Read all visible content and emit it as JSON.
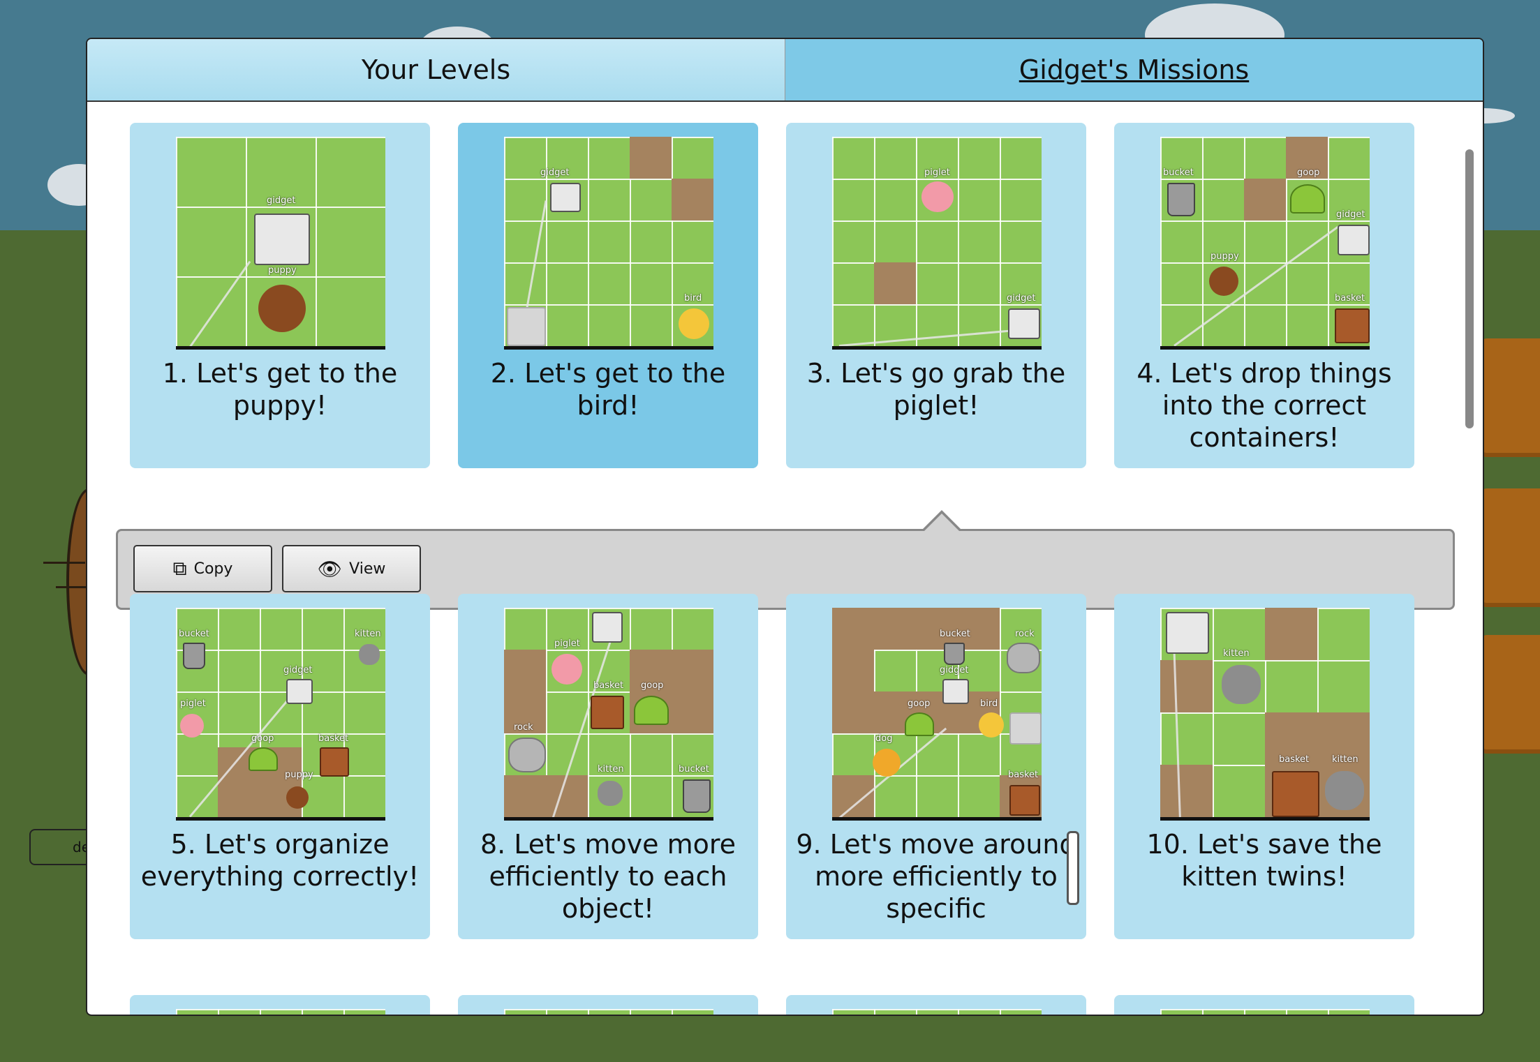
{
  "tabs": {
    "your_levels": "Your Levels",
    "missions": "Gidget's Missions"
  },
  "actions": {
    "copy": "Copy",
    "view": "View"
  },
  "background": {
    "button_text": "de"
  },
  "levels": [
    {
      "title": "1. Let's get to the puppy!",
      "labels": [
        "gidget",
        "puppy"
      ]
    },
    {
      "title": "2. Let's get to the bird!",
      "labels": [
        "gidget",
        "bird"
      ]
    },
    {
      "title": "3. Let's go grab the piglet!",
      "labels": [
        "piglet",
        "gidget"
      ]
    },
    {
      "title": "4. Let's drop things into the correct containers!",
      "labels": [
        "bucket",
        "goop",
        "gidget",
        "puppy",
        "basket"
      ]
    },
    {
      "title": "5. Let's organize everything correctly!",
      "labels": [
        "bucket",
        "kitten",
        "gidget",
        "piglet",
        "goop",
        "basket",
        "puppy"
      ]
    },
    {
      "title": "8. Let's move more efficiently to each object!",
      "labels": [
        "piglet",
        "basket",
        "goop",
        "rock",
        "kitten",
        "bucket"
      ]
    },
    {
      "title": "9. Let's move around more efficiently to specific",
      "labels": [
        "bucket",
        "rock",
        "gidget",
        "goop",
        "bird",
        "dog",
        "basket"
      ]
    },
    {
      "title": "10. Let's save the kitten twins!",
      "labels": [
        "kitten",
        "basket",
        "kitten"
      ]
    }
  ]
}
